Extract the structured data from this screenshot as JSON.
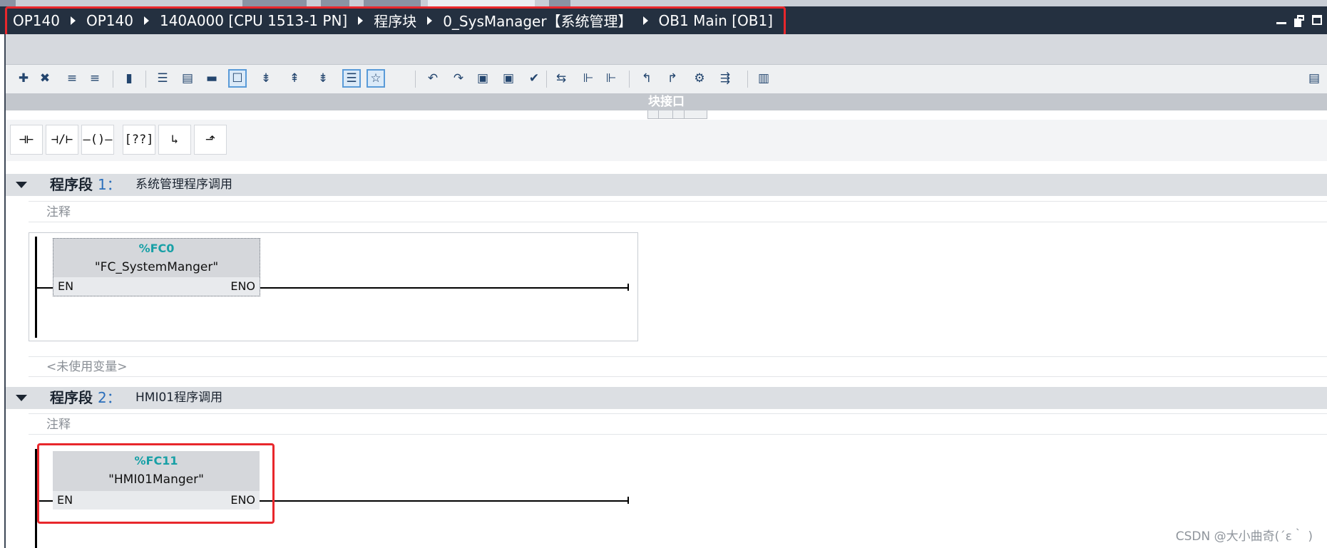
{
  "breadcrumb": [
    "OP140",
    "OP140",
    "140A000 [CPU 1513-1 PN]",
    "程序块",
    "0_SysManager【系统管理】",
    "OB1 Main [OB1]"
  ],
  "window_controls": [
    "minimize-icon",
    "restore-icon",
    "maximize-icon"
  ],
  "toolbar": {
    "icons": [
      "insert-network-icon",
      "delete-network-icon",
      "insert-row-icon",
      "delete-row-icon",
      "tag-table-icon",
      "absolute-operands-icon",
      "favorites-icon",
      "library-icon",
      "comments-toggle-icon",
      "display-tags-icon",
      "plc-tags-icon",
      "symbolic-info-icon",
      "network-comments-icon",
      "favorites-toggle-icon",
      "go-online-icon",
      "go-offline-icon",
      "monitor-icon",
      "monitor-all-icon",
      "check-icon",
      "compare-icon",
      "indent-icon",
      "outdent-icon",
      "previous-error-icon",
      "next-error-icon",
      "cross-reference-icon",
      "call-structure-icon",
      "assignment-icon"
    ],
    "active": [
      "comments-toggle-icon",
      "network-comments-icon",
      "favorites-toggle-icon"
    ]
  },
  "block_interface": {
    "label": "块接口"
  },
  "lad_instructions": [
    {
      "name": "no-contact-icon",
      "glyph": "⊣⊢"
    },
    {
      "name": "nc-contact-icon",
      "glyph": "⊣/⊢"
    },
    {
      "name": "coil-icon",
      "glyph": "–()–"
    },
    {
      "name": "empty-box-icon",
      "glyph": "[??]"
    },
    {
      "name": "open-branch-icon",
      "glyph": "↳"
    },
    {
      "name": "close-branch-icon",
      "glyph": "⬏"
    }
  ],
  "networks": [
    {
      "label": "程序段",
      "number": "1：",
      "title": "系统管理程序调用",
      "comment": "注释",
      "block": {
        "address": "%FC0",
        "name": "\"FC_SystemManger\"",
        "en": "EN",
        "eno": "ENO"
      }
    },
    {
      "label": "程序段",
      "number": "2：",
      "title": "HMI01程序调用",
      "comment": "注释",
      "block": {
        "address": "%FC11",
        "name": "\"HMI01Manger\"",
        "en": "EN",
        "eno": "ENO"
      }
    }
  ],
  "unused_variables": "<未使用变量>",
  "watermark": "CSDN @大小曲奇(´ε｀ )",
  "colors": {
    "titlebar": "#243040",
    "highlight": "#e8272c",
    "address": "#18a0a6",
    "network_number": "#2a6ebb",
    "block_fill": "#d5d7db"
  }
}
